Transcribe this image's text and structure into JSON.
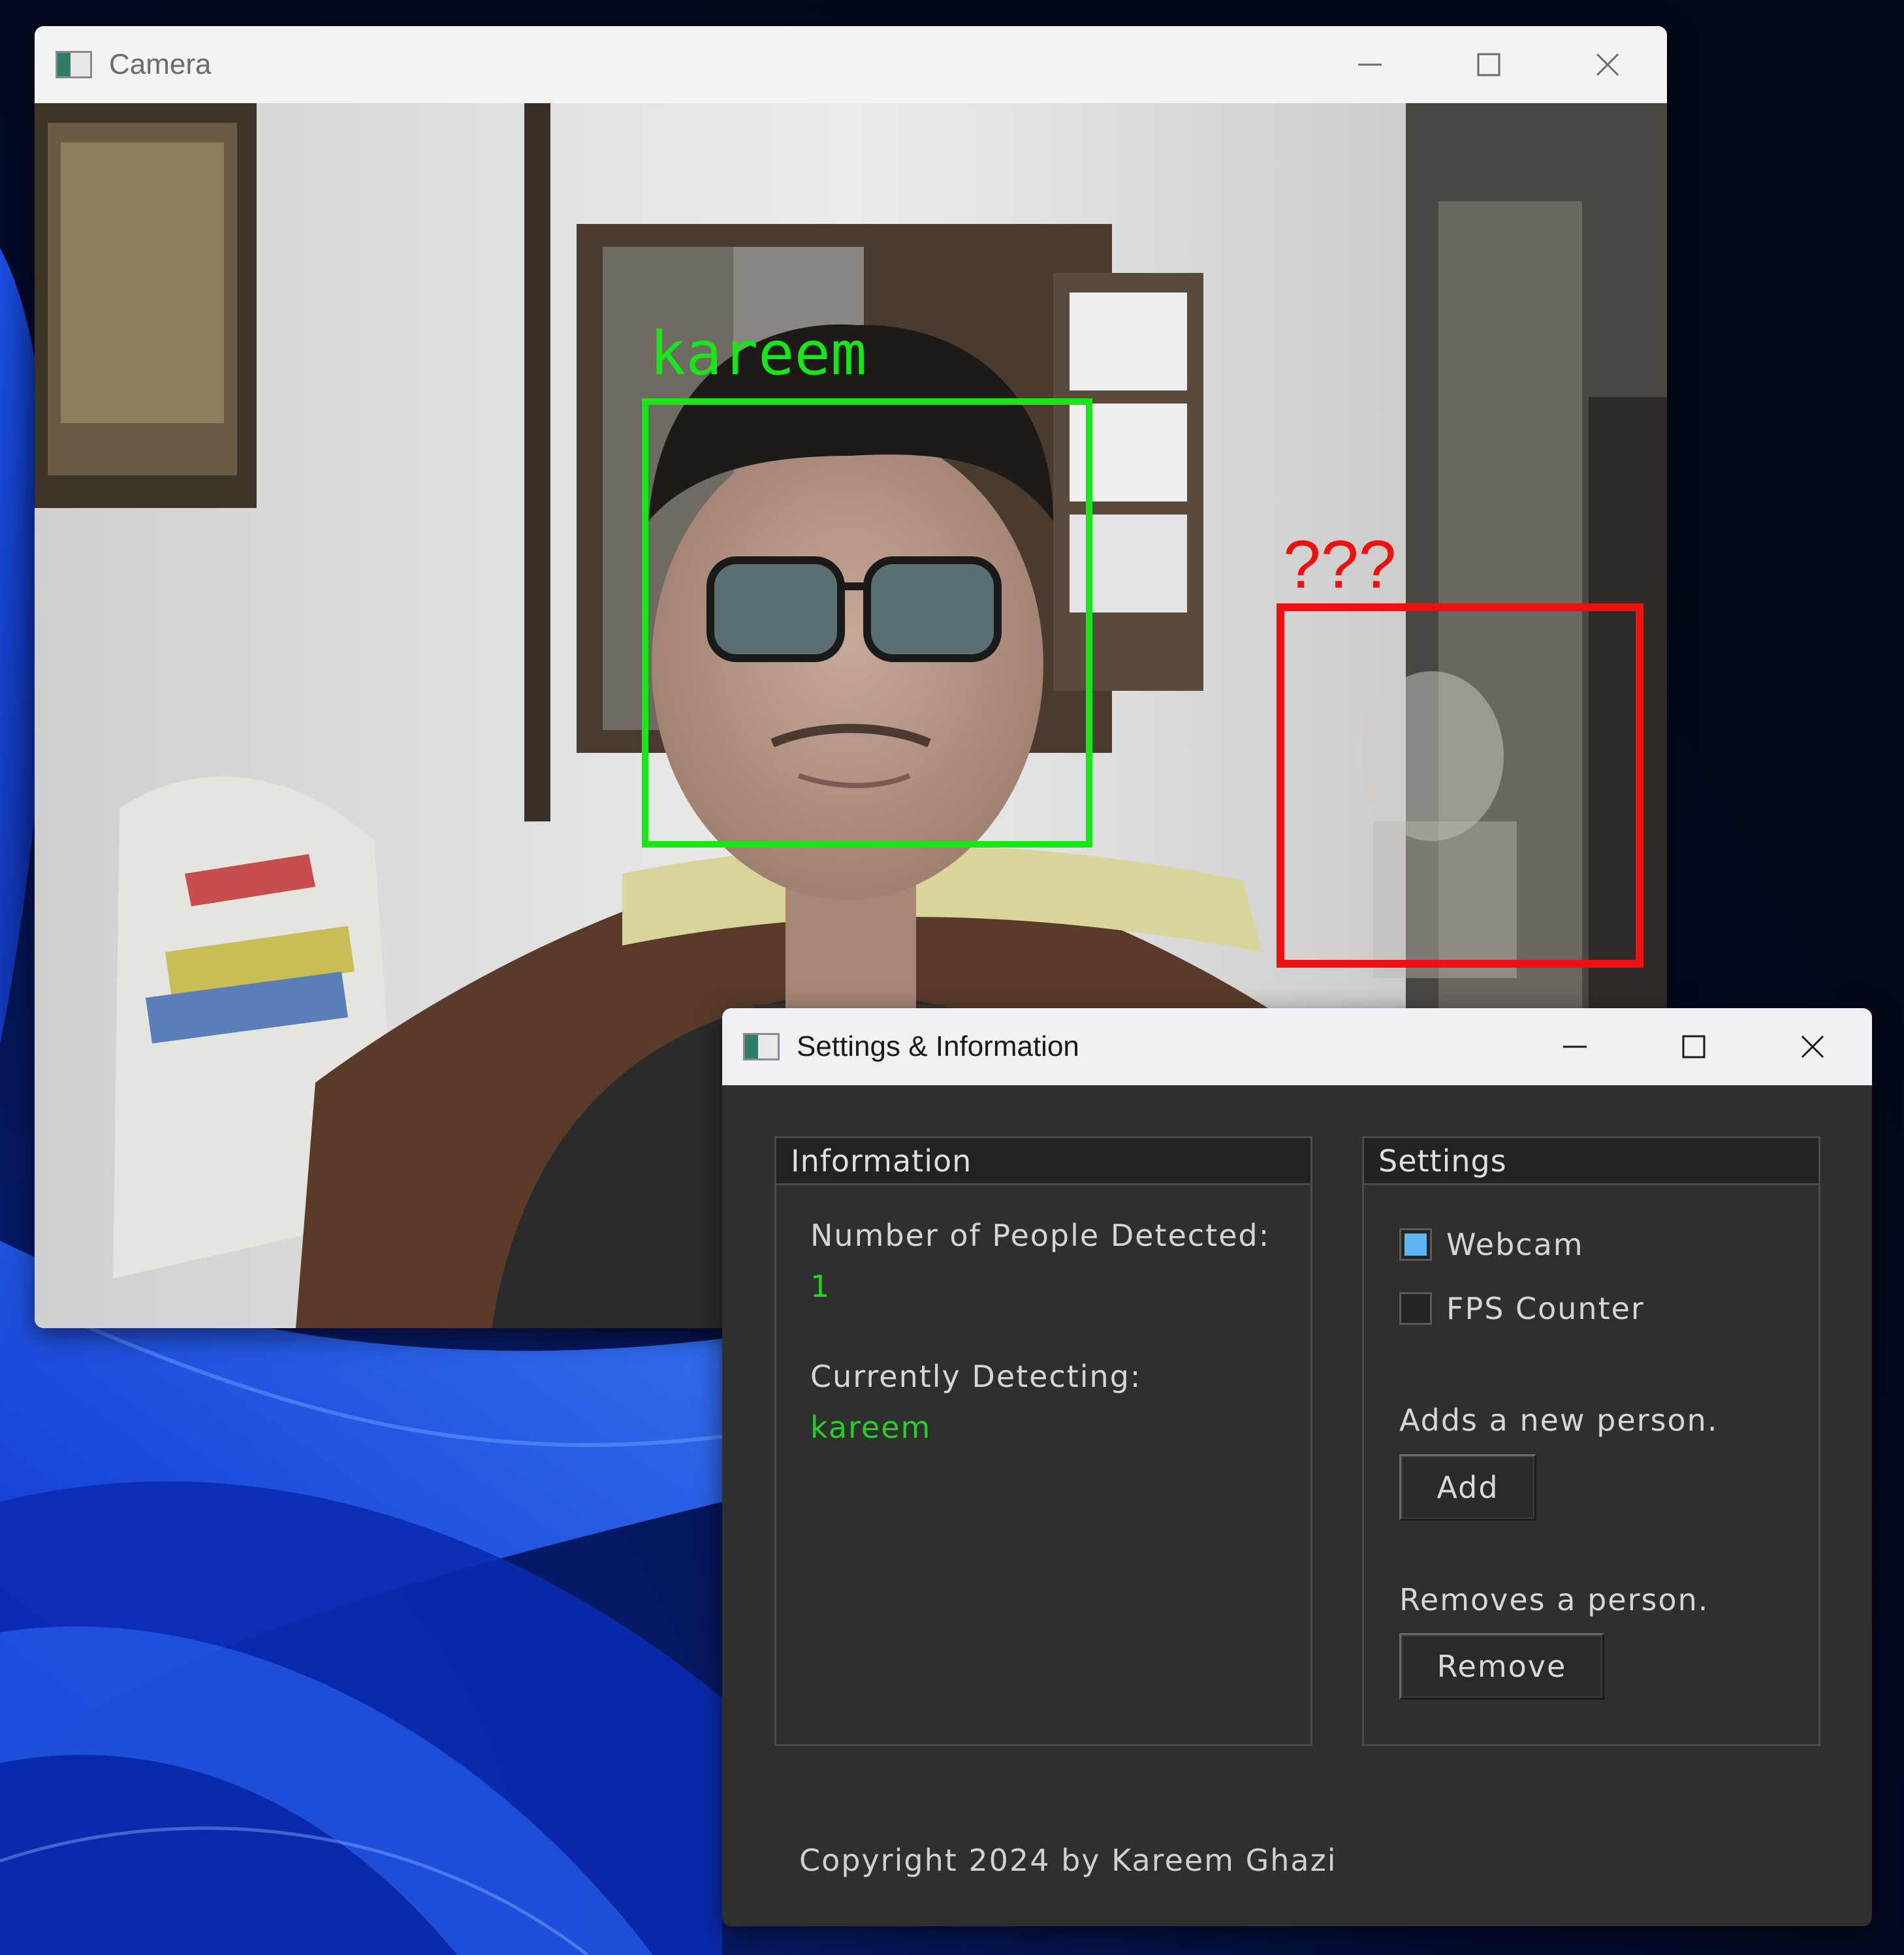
{
  "camera_window": {
    "title": "Camera",
    "detections": [
      {
        "label": "kareem",
        "color": "#19e619"
      },
      {
        "label": "???",
        "color": "#ef1111"
      }
    ]
  },
  "settings_window": {
    "title": "Settings & Information",
    "information": {
      "header": "Information",
      "people_label": "Number of People Detected:",
      "people_value": "1",
      "detecting_label": "Currently Detecting:",
      "detecting_value": "kareem"
    },
    "settings": {
      "header": "Settings",
      "webcam_label": "Webcam",
      "webcam_checked": true,
      "fps_label": "FPS Counter",
      "fps_checked": false,
      "add_hint": "Adds a new person.",
      "add_button": "Add",
      "remove_hint": "Removes a person.",
      "remove_button": "Remove"
    },
    "copyright": "Copyright 2024 by Kareem Ghazi"
  },
  "colors": {
    "known_face": "#19e619",
    "unknown_face": "#ef1111",
    "value_text": "#26d126",
    "checkbox_fill": "#5db6f3",
    "panel_bg": "#2f302e"
  }
}
